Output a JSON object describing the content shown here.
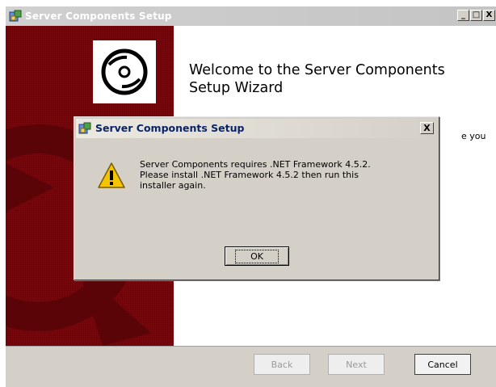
{
  "window": {
    "title": "Server Components Setup",
    "controls": {
      "minimize": "_",
      "maximize": "□",
      "close": "X"
    }
  },
  "welcome": {
    "heading": "Welcome to the Server Components Setup Wizard",
    "partial_text": "e you"
  },
  "footer": {
    "back_label": "Back",
    "next_label": "Next",
    "cancel_label": "Cancel"
  },
  "dialog": {
    "title": "Server Components Setup",
    "close_glyph": "X",
    "message_line1": "Server Components requires .NET Framework 4.5.2.",
    "message_line2": "Please install .NET Framework 4.5.2 then run this",
    "message_line3": "installer again.",
    "ok_label": "OK",
    "icon": "warning-icon"
  },
  "colors": {
    "banner": "#7a0d12",
    "dialog_title_text": "#0a246a",
    "warning_yellow": "#f5c400"
  }
}
